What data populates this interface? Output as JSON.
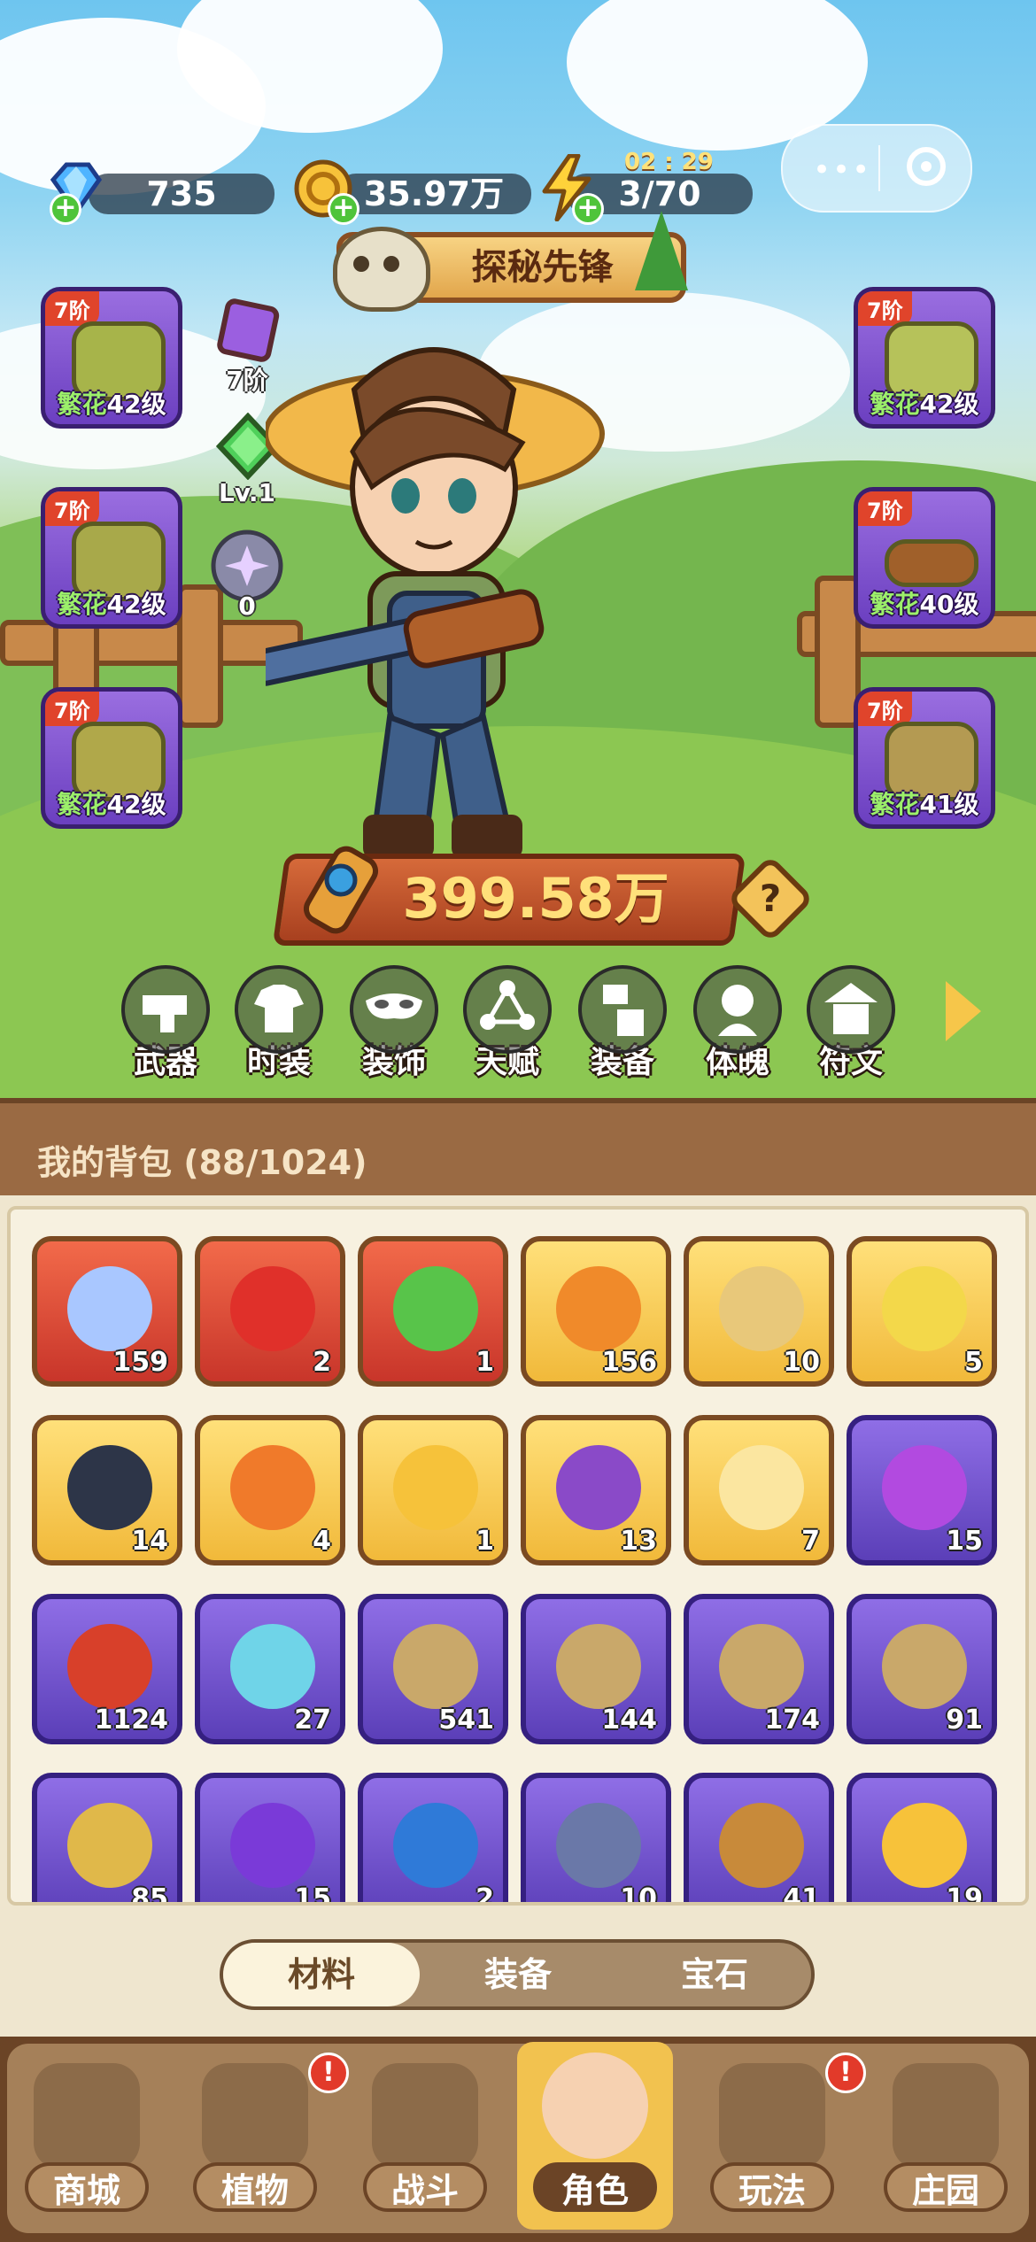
{
  "topbar": {
    "gems": "735",
    "coins": "35.97万",
    "energy": "3/70",
    "energy_timer": "02 : 29"
  },
  "title_banner": "探秘先锋",
  "equipment_left": [
    {
      "tier": "7阶",
      "quality": "繁花",
      "level": "42级"
    },
    {
      "tier": "7阶",
      "quality": "繁花",
      "level": "42级"
    },
    {
      "tier": "7阶",
      "quality": "繁花",
      "level": "42级"
    }
  ],
  "equipment_right": [
    {
      "tier": "7阶",
      "quality": "繁花",
      "level": "42级"
    },
    {
      "tier": "7阶",
      "quality": "繁花",
      "level": "40级"
    },
    {
      "tier": "7阶",
      "quality": "繁花",
      "level": "41级"
    }
  ],
  "mini_stats": {
    "rune_tier": "7阶",
    "gem_level": "Lv.1",
    "orb_count": "0"
  },
  "power": "399.58万",
  "help": "?",
  "tabs": [
    "武器",
    "时装",
    "装饰",
    "天赋",
    "装备",
    "体魄",
    "符文"
  ],
  "bag": {
    "title": "我的背包 (88/1024)",
    "items": [
      {
        "count": "159",
        "rarity": "red",
        "color": "#a9c7ff"
      },
      {
        "count": "2",
        "rarity": "red",
        "color": "#e0302a"
      },
      {
        "count": "1",
        "rarity": "red",
        "color": "#58c44a"
      },
      {
        "count": "156",
        "rarity": "gold",
        "color": "#f08a2a"
      },
      {
        "count": "10",
        "rarity": "gold",
        "color": "#e8c87a"
      },
      {
        "count": "5",
        "rarity": "gold",
        "color": "#f3d84a"
      },
      {
        "count": "14",
        "rarity": "gold",
        "color": "#2d3548"
      },
      {
        "count": "4",
        "rarity": "gold",
        "color": "#f07a2a"
      },
      {
        "count": "1",
        "rarity": "gold",
        "color": "#f6c23a"
      },
      {
        "count": "13",
        "rarity": "gold",
        "color": "#8a4ac8"
      },
      {
        "count": "7",
        "rarity": "gold",
        "color": "#fbe6a0"
      },
      {
        "count": "15",
        "rarity": "purple",
        "color": "#b24ae0"
      },
      {
        "count": "1124",
        "rarity": "purple",
        "color": "#d8402a"
      },
      {
        "count": "27",
        "rarity": "purple",
        "color": "#6fd4e8"
      },
      {
        "count": "541",
        "rarity": "purple",
        "color": "#c9a86a"
      },
      {
        "count": "144",
        "rarity": "purple",
        "color": "#c9a86a"
      },
      {
        "count": "174",
        "rarity": "purple",
        "color": "#c9a86a"
      },
      {
        "count": "91",
        "rarity": "purple",
        "color": "#c9a86a"
      },
      {
        "count": "85",
        "rarity": "purple",
        "color": "#e0b84a"
      },
      {
        "count": "15",
        "rarity": "purple",
        "color": "#7a3ad8"
      },
      {
        "count": "2",
        "rarity": "purple",
        "color": "#2f7ad8"
      },
      {
        "count": "10",
        "rarity": "purple",
        "color": "#6a78a8"
      },
      {
        "count": "41",
        "rarity": "purple",
        "color": "#c88a3a"
      },
      {
        "count": "19",
        "rarity": "purple",
        "color": "#f7c23a"
      }
    ]
  },
  "segment": {
    "tabs": [
      "材料",
      "装备",
      "宝石"
    ],
    "active": "材料"
  },
  "bottom_nav": [
    {
      "label": "商城",
      "badge": ""
    },
    {
      "label": "植物",
      "badge": "!"
    },
    {
      "label": "战斗",
      "badge": ""
    },
    {
      "label": "角色",
      "badge": "",
      "active": true
    },
    {
      "label": "玩法",
      "badge": "!"
    },
    {
      "label": "庄园",
      "badge": ""
    }
  ]
}
